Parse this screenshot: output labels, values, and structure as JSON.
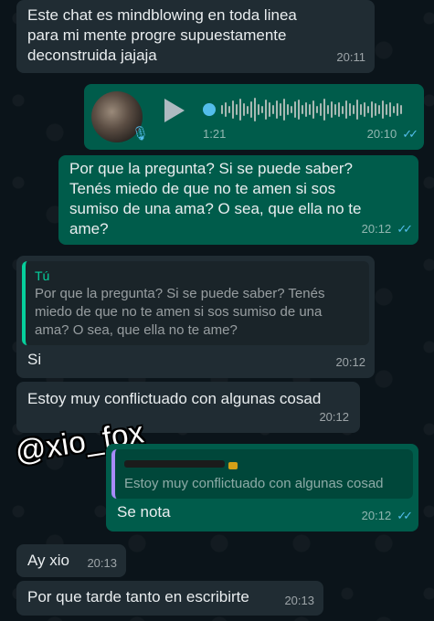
{
  "messages": [
    {
      "id": "m1",
      "text": "Este chat es mindblowing en toda linea\npara mi mente progre supuestamente\ndeconstruida jajaja",
      "time": "20:11"
    },
    {
      "id": "m2",
      "type": "voice",
      "duration": "1:21",
      "time": "20:10"
    },
    {
      "id": "m3",
      "text": "Por que la pregunta? Si se puede saber?\nTenés miedo de que no te amen si sos\nsumiso de una ama? O sea, que ella no te\name?",
      "time": "20:12"
    },
    {
      "id": "m4",
      "quote_author": "Tú",
      "quote_text": "Por que la pregunta? Si se puede saber? Tenés\nmiedo de que no te amen si sos sumiso de una\nama? O sea, que ella no te ame?",
      "text": "Si",
      "time": "20:12"
    },
    {
      "id": "m5",
      "text": "Estoy muy conflictuado con algunas cosad",
      "time": "20:12"
    },
    {
      "id": "m6",
      "quote_text": "Estoy muy conflictuado con algunas cosad",
      "text": "Se nota",
      "time": "20:12"
    },
    {
      "id": "m7",
      "text": "Ay xio",
      "time": "20:13"
    },
    {
      "id": "m8",
      "text": "Por que tarde tanto en escribirte",
      "time": "20:13"
    }
  ],
  "watermark": "@xio_fox",
  "colors": {
    "incoming": "#202c33",
    "outgoing": "#005c4b",
    "read_ticks": "#53bdeb",
    "background": "#0b141a"
  },
  "icons": {
    "play": "play-icon",
    "mic": "mic-icon",
    "ticks": "double-check-icon"
  }
}
